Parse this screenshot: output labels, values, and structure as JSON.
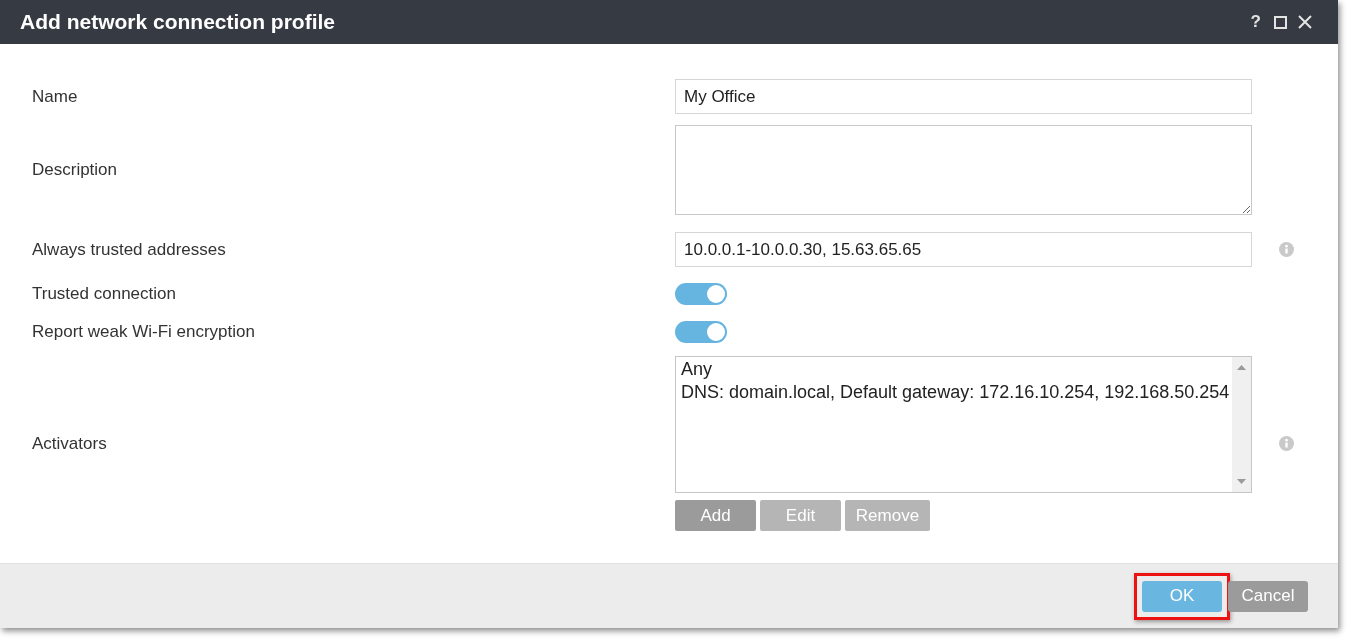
{
  "window": {
    "title": "Add network connection profile",
    "help_label": "?"
  },
  "fields": [
    {
      "kind": "text",
      "label": "Name",
      "value": "My Office",
      "info": false
    },
    {
      "kind": "textarea",
      "label": "Description",
      "info": false
    },
    {
      "kind": "text",
      "label": "Always trusted addresses",
      "value": "10.0.0.1-10.0.0.30, 15.63.65.65",
      "info": true
    },
    {
      "kind": "toggle",
      "label": "Trusted connection",
      "on": true,
      "info": false
    },
    {
      "kind": "toggle",
      "label": "Report weak Wi-Fi encryption",
      "on": true,
      "info": false
    },
    {
      "kind": "list",
      "label": "Activators",
      "items": [
        "Any",
        "DNS: domain.local, Default gateway: 172.16.10.254, 192.168.50.254"
      ],
      "info": true,
      "buttons": [
        {
          "label": "Add",
          "disabled": false
        },
        {
          "label": "Edit",
          "disabled": true
        },
        {
          "label": "Remove",
          "disabled": true
        }
      ]
    }
  ],
  "footer": {
    "buttons": [
      {
        "label": "OK",
        "kind": "primary",
        "highlighted": true
      },
      {
        "label": "Cancel",
        "kind": "secondary",
        "highlighted": false
      }
    ]
  }
}
